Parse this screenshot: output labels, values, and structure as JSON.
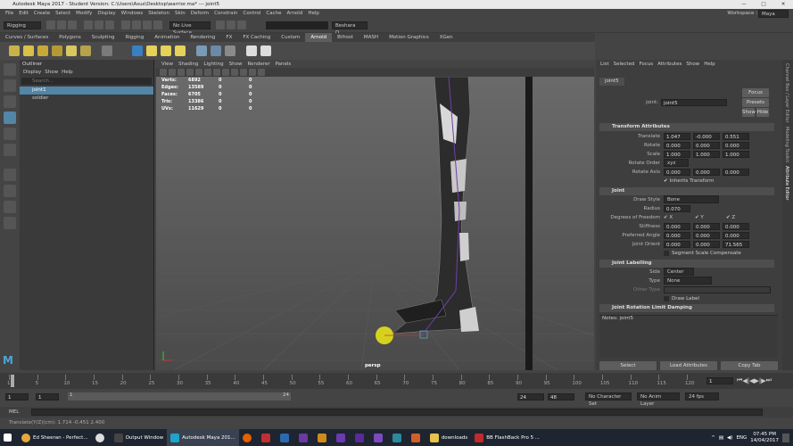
{
  "window": {
    "title": "Autodesk Maya 2017 - Student Version: C:\\Users\\Asus\\Desktop\\warrior.ma* --- joint5",
    "minimize": "—",
    "maximize": "□",
    "close": "✕"
  },
  "menu": [
    "File",
    "Edit",
    "Create",
    "Select",
    "Modify",
    "Display",
    "Windows",
    "Skeleton",
    "Skin",
    "Deform",
    "Constrain",
    "Control",
    "Cache",
    "Arnold",
    "Help"
  ],
  "workspace": {
    "label": "Workspace :",
    "value": "Maya Classic"
  },
  "status": {
    "menuset": "Rigging",
    "live_surface": "No Live Surface",
    "user": "Beshara O..."
  },
  "shelf_tabs": [
    "Curves / Surfaces",
    "Polygons",
    "Sculpting",
    "Rigging",
    "Animation",
    "Rendering",
    "FX",
    "FX Caching",
    "Custom",
    "Arnold",
    "Bifrost",
    "MASH",
    "Motion Graphics",
    "XGen"
  ],
  "shelf_active": "Arnold",
  "outliner": {
    "title": "Outliner",
    "menu": [
      "Display",
      "Show",
      "Help"
    ],
    "search_placeholder": "Search...",
    "items": [
      "joint1",
      "soldier"
    ]
  },
  "viewport": {
    "menu": [
      "View",
      "Shading",
      "Lighting",
      "Show",
      "Renderer",
      "Panels"
    ],
    "hud": [
      {
        "k": "Verts:",
        "a": "6892",
        "b": "0",
        "c": "0"
      },
      {
        "k": "Edges:",
        "a": "13589",
        "b": "0",
        "c": "0"
      },
      {
        "k": "Faces:",
        "a": "6705",
        "b": "0",
        "c": "0"
      },
      {
        "k": "Tris:",
        "a": "13386",
        "b": "0",
        "c": "0"
      },
      {
        "k": "UVs:",
        "a": "11629",
        "b": "0",
        "c": "0"
      }
    ],
    "camera": "persp"
  },
  "attr_editor": {
    "menu": [
      "List",
      "Selected",
      "Focus",
      "Attributes",
      "Show",
      "Help"
    ],
    "tab": "joint5",
    "node_label": "joint:",
    "node_value": "joint5",
    "focus": "Focus",
    "presets": "Presets",
    "show": "Show",
    "hide": "Hide",
    "sections": {
      "transform": "Transform Attributes",
      "joint": "Joint",
      "labelling": "Joint Labelling",
      "rotation_limit": "Joint Rotation Limit Damping"
    },
    "translate": {
      "label": "Translate",
      "x": "1.047",
      "y": "-0.000",
      "z": "0.551"
    },
    "rotate": {
      "label": "Rotate",
      "x": "0.000",
      "y": "0.000",
      "z": "0.000"
    },
    "scale": {
      "label": "Scale",
      "x": "1.000",
      "y": "1.000",
      "z": "1.000"
    },
    "rotate_order": {
      "label": "Rotate Order",
      "value": "xyz"
    },
    "rotate_axis": {
      "label": "Rotate Axis",
      "x": "0.000",
      "y": "0.000",
      "z": "0.000"
    },
    "inherits": "Inherits Transform",
    "draw_style": {
      "label": "Draw Style",
      "value": "Bone"
    },
    "radius": {
      "label": "Radius",
      "value": "0.070"
    },
    "dof": {
      "label": "Degrees of Freedom",
      "x": "X",
      "y": "Y",
      "z": "Z"
    },
    "stiffness": {
      "label": "Stiffness",
      "x": "0.000",
      "y": "0.000",
      "z": "0.000"
    },
    "preferred": {
      "label": "Preferred Angle",
      "x": "0.000",
      "y": "0.000",
      "z": "0.000"
    },
    "orient": {
      "label": "Joint Orient",
      "x": "0.000",
      "y": "0.000",
      "z": "71.565"
    },
    "segment": "Segment Scale Compensate",
    "side": {
      "label": "Side",
      "value": "Center"
    },
    "type": {
      "label": "Type",
      "value": "None"
    },
    "other_type": {
      "label": "Other Type"
    },
    "draw_label": "Draw Label",
    "notes": "Notes: joint5",
    "buttons": [
      "Select",
      "Load Attributes",
      "Copy Tab"
    ]
  },
  "side_tabs": [
    "Channel Box / Layer Editor",
    "Modeling Toolkit",
    "Attribute Editor"
  ],
  "timeline": {
    "ticks": [
      "1",
      "5",
      "10",
      "15",
      "20",
      "25",
      "30",
      "35",
      "40",
      "45",
      "50",
      "55",
      "60",
      "65",
      "70",
      "75",
      "80",
      "85",
      "90",
      "95",
      "100",
      "105",
      "110",
      "115",
      "120"
    ],
    "current": "1"
  },
  "range": {
    "start": "1",
    "start2": "1",
    "range_start": "1",
    "range_end": "24",
    "end": "24",
    "end2": "48",
    "char_set": "No Character Set",
    "anim_layer": "No Anim Layer",
    "fps": "24 fps"
  },
  "mel": {
    "label": "MEL"
  },
  "help_line": "Translate(Y/Z)(cm):  1.714   -0.451   2.400",
  "taskbar": {
    "items": [
      "Ed Sheeran - Perfect...",
      "Output Window",
      "Autodesk Maya 201...",
      "downloads",
      "BB FlashBack Pro 5 ..."
    ],
    "lang": "ENG",
    "time": "07:45 PM",
    "date": "14/04/2017"
  }
}
